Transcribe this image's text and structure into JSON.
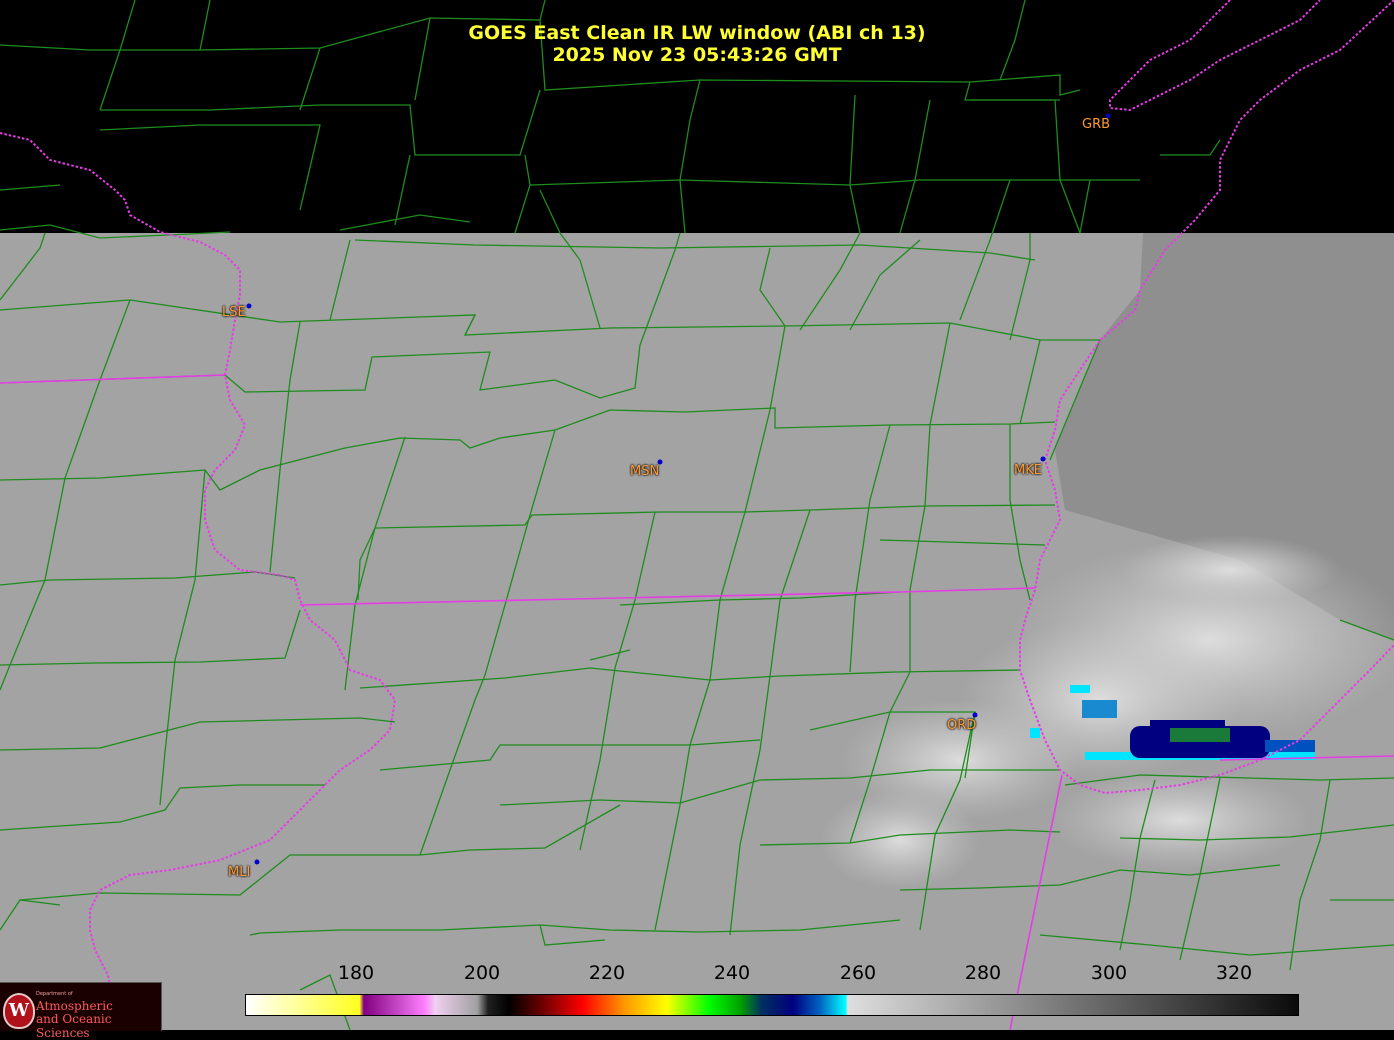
{
  "title": {
    "line1": "GOES East Clean IR LW window (ABI ch 13)",
    "line2": "2025 Nov 23  05:43:26 GMT"
  },
  "cities": [
    {
      "code": "GRB"
    },
    {
      "code": "LSE"
    },
    {
      "code": "MSN"
    },
    {
      "code": "MKE"
    },
    {
      "code": "ORD"
    },
    {
      "code": "MLI"
    }
  ],
  "colorbar": {
    "ticks": [
      "180",
      "200",
      "220",
      "240",
      "260",
      "280",
      "300",
      "320"
    ],
    "min": 162,
    "max": 330
  },
  "logo": {
    "seal": "W",
    "line1": "Department of",
    "line2": "Atmospheric",
    "line3": "and Oceanic Sciences"
  },
  "colors": {
    "title": "#ffff33",
    "county_lines": "#1e8c1e",
    "state_lines": "#e63ce6",
    "city_labels": "#ff9a33",
    "land_gray": "#a3a3a3",
    "lake_gray": "#8f8f8f"
  }
}
